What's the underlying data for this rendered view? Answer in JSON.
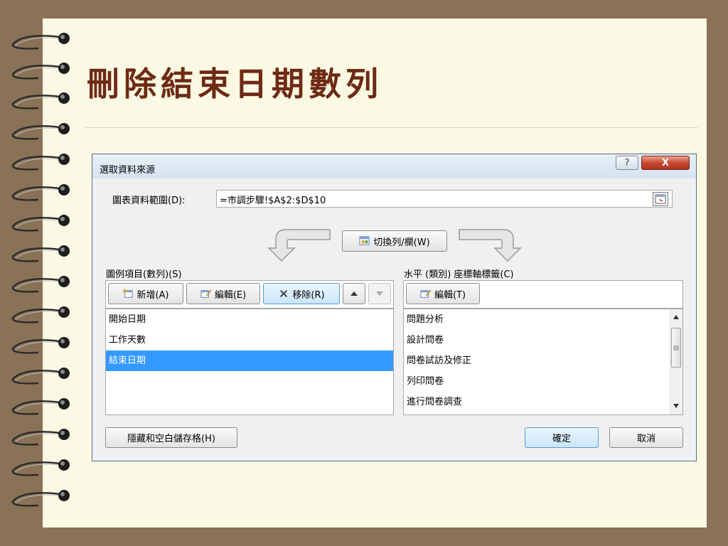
{
  "slide": {
    "title": "刪除結束日期數列"
  },
  "dialog": {
    "title": "選取資料來源",
    "help_label": "?",
    "close_label": "X",
    "range_label": "圖表資料範圍(D):",
    "range_value": "=市調步驟!$A$2:$D$10",
    "switch_button": "切換列/欄(W)",
    "legend": {
      "label": "圖例項目(數列)(S)",
      "add_button": "新增(A)",
      "edit_button": "編輯(E)",
      "remove_button": "移除(R)",
      "items": [
        {
          "label": "開始日期",
          "selected": false
        },
        {
          "label": "工作天數",
          "selected": false
        },
        {
          "label": "結束日期",
          "selected": true
        }
      ]
    },
    "axis": {
      "label": "水平 (類別) 座標軸標籤(C)",
      "edit_button": "編輯(T)",
      "items": [
        "問題分析",
        "設計問卷",
        "問卷試訪及修正",
        "列印問卷",
        "進行問卷調查"
      ]
    },
    "hidden_cells_button": "隱藏和空白儲存格(H)",
    "ok_button": "確定",
    "cancel_button": "取消",
    "colors": {
      "selection": "#3399ff",
      "title": "#6e2a14",
      "close": "#c5452c"
    }
  }
}
